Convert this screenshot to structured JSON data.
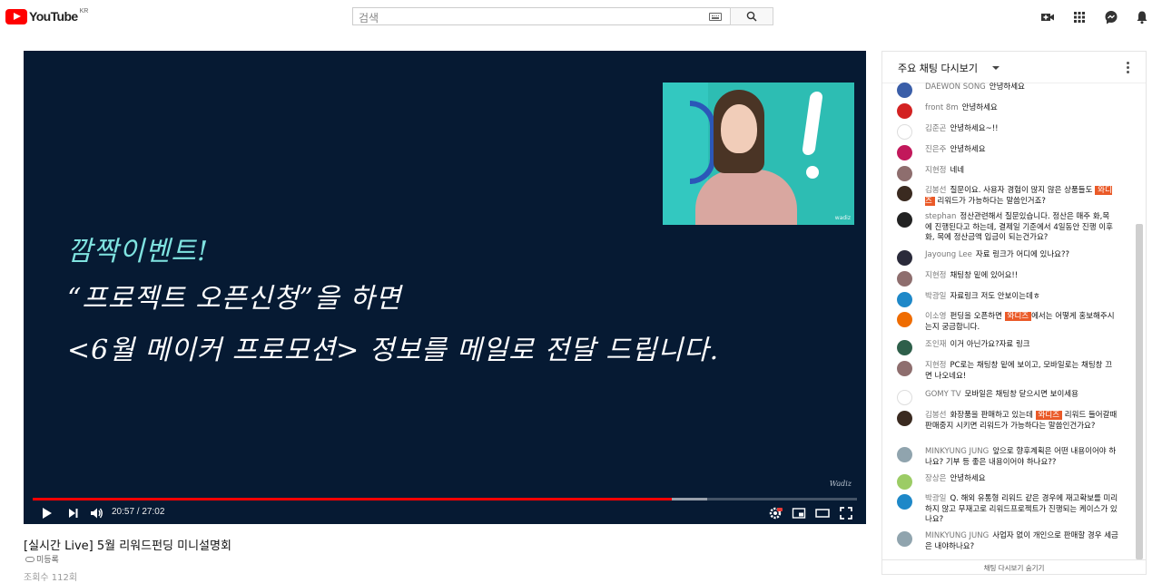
{
  "header": {
    "logo_text": "YouTube",
    "logo_country": "KR",
    "search_placeholder": "검색"
  },
  "player": {
    "overlay_lines": [
      "깜짝이벤트!",
      "“프로젝트 오픈신청”을 하면",
      "<6월 메이커 프로모션> 정보를 메일로 전달 드립니다."
    ],
    "watermark": "Wadiz",
    "cam_watermark": "wadiz",
    "time_display": "20:57 / 27:02",
    "progress_fraction": 0.775
  },
  "video": {
    "title": "[실시간 Live] 5월 리워드펀딩 미니설명회",
    "unlisted_label": "미등록",
    "views_text": "조회수 112회"
  },
  "chat": {
    "title": "주요 채팅 다시보기",
    "footer": "채팅 다시보기 숨기기",
    "messages": [
      {
        "author": "DAEWON SONG",
        "pre": "안녕하세요",
        "tag": "",
        "post": "",
        "color": "#3a5ea8"
      },
      {
        "author": "front 8m",
        "pre": "안녕하세요",
        "tag": "",
        "post": "",
        "color": "#d32222"
      },
      {
        "author": "김준곤",
        "pre": "안녕하세요~!!",
        "tag": "",
        "post": "",
        "color": "#ffffff"
      },
      {
        "author": "진은주",
        "pre": "안녕하세요",
        "tag": "",
        "post": "",
        "color": "#c2185b"
      },
      {
        "author": "지현정",
        "pre": "네네",
        "tag": "",
        "post": "",
        "color": "#8e6e6e"
      },
      {
        "author": "김봉선",
        "pre": "질문이요. 사용자 경험이 많지 않은 상품들도 ",
        "tag": "와디즈",
        "post": " 리워드가 가능하다는 말씀인거죠?",
        "color": "#3a2a20"
      },
      {
        "author": "stephan",
        "pre": "정산관련해서 질문있습니다. 정산은 매주 화,목 에 진행된다고 하는데, 결제일 기준에서 4일동안 진행 이후 화, 목에 정산금액 입금이 되는건가요?",
        "tag": "",
        "post": "",
        "color": "#222222"
      },
      {
        "author": "Jayoung Lee",
        "pre": "자료 링크가 어디에 있나요??",
        "tag": "",
        "post": "",
        "color": "#2a2a3a"
      },
      {
        "author": "지현정",
        "pre": "채팅창 밑에 있어요!!",
        "tag": "",
        "post": "",
        "color": "#8e6e6e"
      },
      {
        "author": "박광일",
        "pre": "자료링크 저도 안보이는데ㅎ",
        "tag": "",
        "post": "",
        "color": "#1e88c8"
      },
      {
        "author": "이소영",
        "pre": "펀딩을 오픈하면 ",
        "tag": "와디즈",
        "post": "에서는 어떻게 홍보해주시는지 궁금합니다.",
        "color": "#ef6c00"
      },
      {
        "author": "조인재",
        "pre": "이거 아닌가요?자료 링크",
        "tag": "",
        "post": "",
        "color": "#2e5f4a"
      },
      {
        "author": "지현정",
        "pre": "PC로는 채팅창 밑에 보이고, 모바일로는 채팅창 끄면 나오네요!",
        "tag": "",
        "post": "",
        "color": "#8e6e6e"
      },
      {
        "author": "GOMY TV",
        "pre": "모바일은 채팅창 닫으시면 보이세용",
        "tag": "",
        "post": "",
        "color": "#ffffff"
      },
      {
        "author": "김봉선",
        "pre": "화장품을 판매하고 있는데 ",
        "tag": "와디즈",
        "post": " 리워드 들어갈때 판매중지 시키면 리워드가 가능하다는 말씀인건가요?",
        "color": "#3a2a20"
      },
      {
        "author": "MINKYUNG JUNG",
        "pre": "앞으로 향후계획은 어떤 내용이어야 하나요? 기부 등 좋은 내용이어야 하나요??",
        "tag": "",
        "post": "",
        "color": "#90a4ae"
      },
      {
        "author": "장상은",
        "pre": "안녕하세요",
        "tag": "",
        "post": "",
        "color": "#9ccc65"
      },
      {
        "author": "박광일",
        "pre": "Q. 해외 유통형 리워드 같은 경우에 재고확보를 미리하지 않고 무재고로 리워드프로젝트가 진행되는 케이스가 있나요?",
        "tag": "",
        "post": "",
        "color": "#1e88c8"
      },
      {
        "author": "MINKYUNG JUNG",
        "pre": "사업자 없이 개인으로 판매할 경우 세금은 내야하나요?",
        "tag": "",
        "post": "",
        "color": "#90a4ae"
      }
    ]
  }
}
